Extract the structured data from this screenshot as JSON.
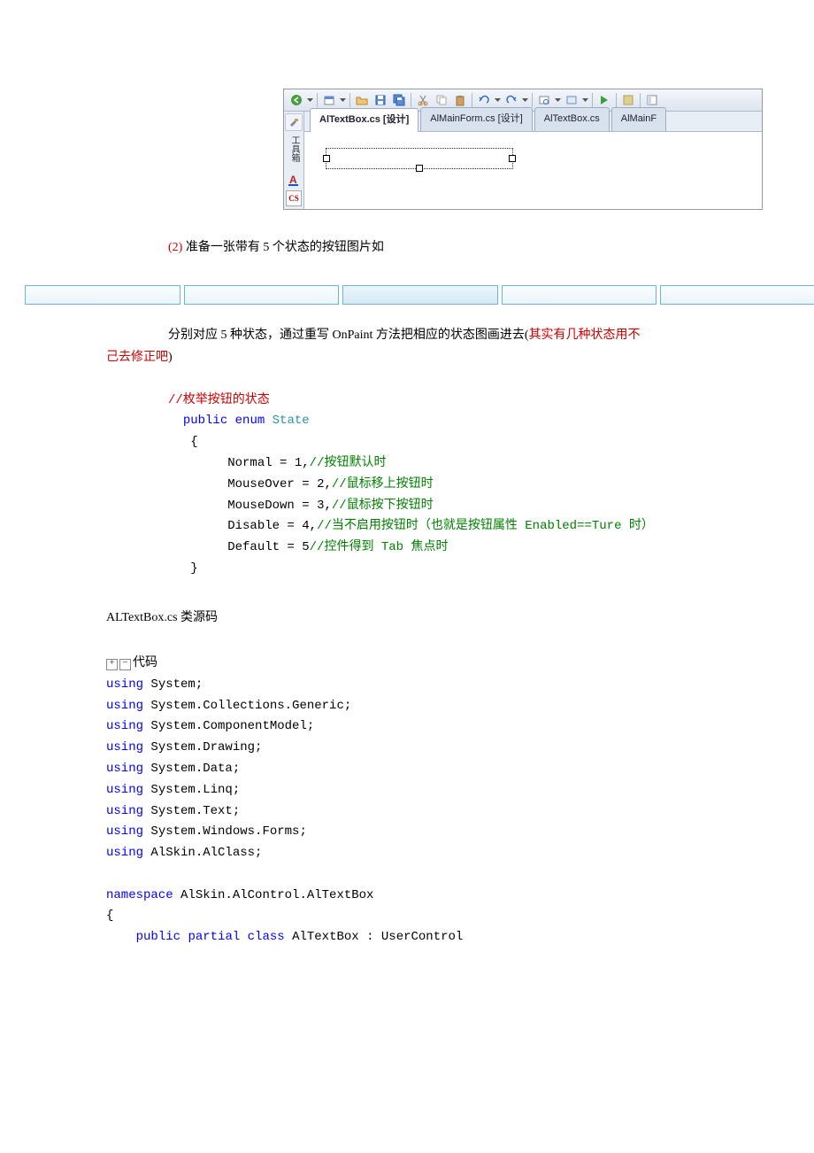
{
  "ide": {
    "tabs": [
      {
        "label": "AlTextBox.cs [设计]",
        "active": true
      },
      {
        "label": "AlMainForm.cs [设计]",
        "active": false
      },
      {
        "label": "AlTextBox.cs",
        "active": false
      },
      {
        "label": "AlMainF",
        "active": false
      }
    ],
    "toolbox_label": "工具箱",
    "cs_label": "CS"
  },
  "para_step": "(2)",
  "para_step_text": "准备一张带有 5 个状态的按钮图片如",
  "para2_a": "分别对应 5 种状态，通过重写 OnPaint 方法把相应的状态图画进去(",
  "para2_b": "其实有几种状态用不",
  "para2_c": "己去修正吧",
  "para2_d": ")",
  "enum_comment": "//枚举按钮的状态",
  "enum_public": "public",
  "enum_enum": "enum",
  "enum_name": "State",
  "enum_lines": [
    {
      "name": "Normal",
      "value": "1",
      "comment": "//按钮默认时"
    },
    {
      "name": "MouseOver",
      "value": "2",
      "comment": "//鼠标移上按钮时"
    },
    {
      "name": "MouseDown",
      "value": "3",
      "comment": "//鼠标按下按钮时"
    },
    {
      "name": "Disable",
      "value": "4",
      "comment": "//当不启用按钮时（也就是按钮属性 Enabled==Ture 时）"
    },
    {
      "name": "Default",
      "value": "5",
      "comment": "//控件得到 Tab 焦点时"
    }
  ],
  "class_source_label": "ALTextBox.cs 类源码",
  "code_label": "代码",
  "usings": [
    "System",
    "System.Collections.Generic",
    "System.ComponentModel",
    "System.Drawing",
    "System.Data",
    "System.Linq",
    "System.Text",
    "System.Windows.Forms",
    "AlSkin.AlClass"
  ],
  "kw_using": "using",
  "kw_namespace": "namespace",
  "ns_name": " AlSkin.AlControl.AlTextBox",
  "kw_public": "public",
  "kw_partial": "partial",
  "kw_class": "class",
  "class_decl_rest": " AlTextBox : UserControl"
}
